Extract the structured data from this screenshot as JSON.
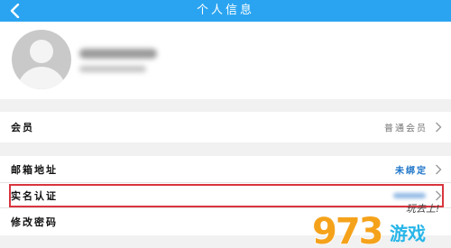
{
  "header": {
    "title": "个人信息"
  },
  "rows": {
    "member": {
      "label": "会员",
      "value": "普通会员"
    },
    "email": {
      "label": "邮箱地址",
      "value": "未绑定"
    },
    "realname": {
      "label": "实名认证"
    },
    "password": {
      "label": "修改密码"
    }
  },
  "watermark": {
    "digits": "973",
    "text": "游戏",
    "slogan": "玩去上!"
  },
  "colors": {
    "header_bg": "#2aa4f1",
    "link_blue": "#1a73c8",
    "highlight_red": "#d9353e",
    "logo_orange": "#f5a21b",
    "logo_cyan": "#29b6e8"
  }
}
